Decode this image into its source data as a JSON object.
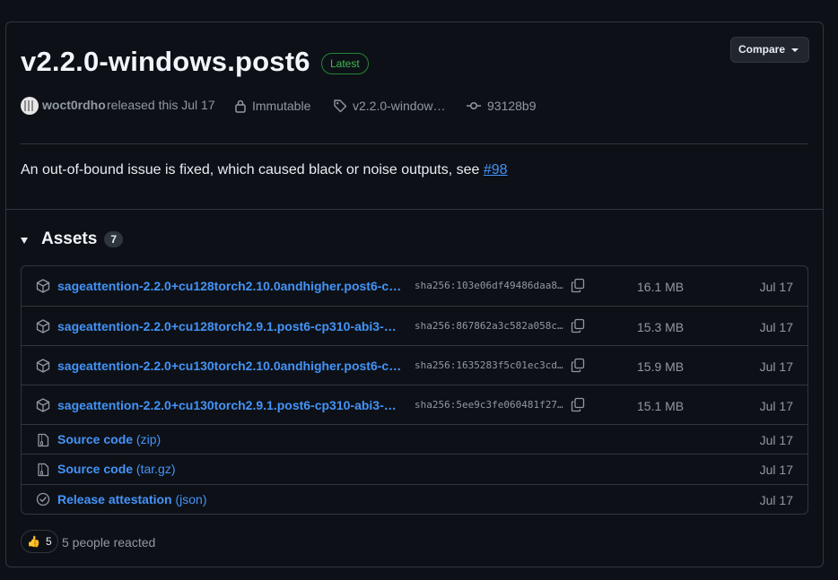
{
  "release": {
    "title": "v2.2.0-windows.post6",
    "latest_badge": "Latest",
    "compare_label": "Compare",
    "author": "woct0rdho",
    "released_text": "released this Jul 17",
    "immutable_label": "Immutable",
    "tag_label": "v2.2.0-window…",
    "commit": "93128b9",
    "body_text": "An out-of-bound issue is fixed, which caused black or noise outputs, see ",
    "body_link": "#98"
  },
  "assets": {
    "label": "Assets",
    "count": "7",
    "files": [
      {
        "name": "sageattention-2.2.0+cu128torch2.10.0andhigher.post6-cp31…",
        "sha": "sha256:103e06df49486daa8…",
        "size": "16.1 MB",
        "date": "Jul 17",
        "icon": "package-icon"
      },
      {
        "name": "sageattention-2.2.0+cu128torch2.9.1.post6-cp310-abi3-win…",
        "sha": "sha256:867862a3c582a058c…",
        "size": "15.3 MB",
        "date": "Jul 17",
        "icon": "package-icon"
      },
      {
        "name": "sageattention-2.2.0+cu130torch2.10.0andhigher.post6-cp31…",
        "sha": "sha256:1635283f5c01ec3cd…",
        "size": "15.9 MB",
        "date": "Jul 17",
        "icon": "package-icon"
      },
      {
        "name": "sageattention-2.2.0+cu130torch2.9.1.post6-cp310-abi3-win…",
        "sha": "sha256:5ee9c3fe060481f27…",
        "size": "15.1 MB",
        "date": "Jul 17",
        "icon": "package-icon"
      }
    ],
    "source": [
      {
        "name": "Source code",
        "ext": "(zip)",
        "date": "Jul 17",
        "icon": "file-zip-icon"
      },
      {
        "name": "Source code",
        "ext": "(tar.gz)",
        "date": "Jul 17",
        "icon": "file-zip-icon"
      },
      {
        "name": "Release attestation",
        "ext": "(json)",
        "date": "Jul 17",
        "icon": "verified-icon"
      }
    ]
  },
  "reactions": {
    "emoji": "👍",
    "count": "5",
    "text": "5 people reacted"
  },
  "colors": {
    "background": "#0d1117",
    "border": "#30363d",
    "link": "#4493f8",
    "muted": "#9198a1",
    "latest_green": "#3fb950"
  }
}
